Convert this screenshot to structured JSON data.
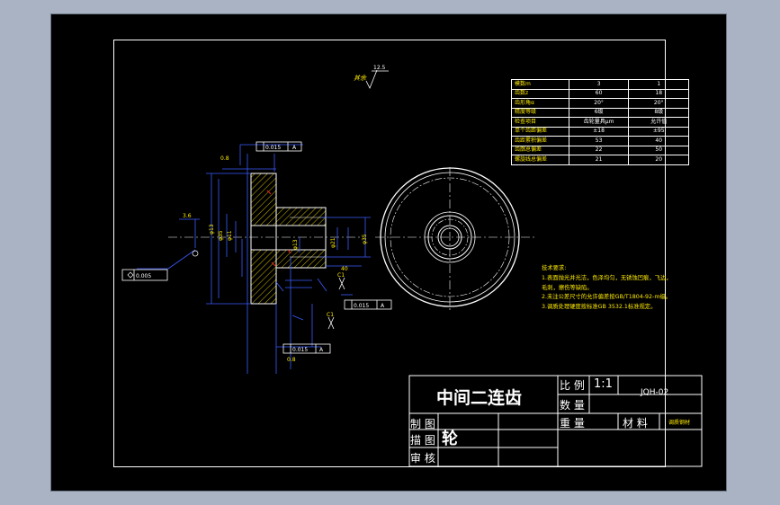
{
  "roughness": {
    "label": "其余",
    "value": "12.5"
  },
  "gear_table": [
    [
      "模数m",
      "3",
      "1"
    ],
    [
      "齿数z",
      "60",
      "18"
    ],
    [
      "齿形角α",
      "20°",
      "20°"
    ],
    [
      "精度等级",
      "6级",
      "8级"
    ],
    [
      "检查项目",
      "齿轮量具μm",
      "允许值"
    ],
    [
      "单个齿距偏差",
      "±18",
      "±95"
    ],
    [
      "齿距累积偏差",
      "53",
      "40"
    ],
    [
      "齿廓总偏差",
      "22",
      "50"
    ],
    [
      "螺旋线总偏差",
      "21",
      "20"
    ]
  ],
  "tech_notes": {
    "title": "技术要求:",
    "lines": [
      "1.表面抛光并光洁，色泽均匀，无锈蚀凹痕，飞边，",
      "   毛刺，擦伤等缺陷。",
      "2.未注公差尺寸的允许偏差按GB/T1804-92-m级。",
      "3.调质处理硬度按标准GB 3532.1标准规定。"
    ]
  },
  "dimensions": {
    "flatness": "0.005",
    "runout_1": "0.015",
    "runout_2": "0.015",
    "runout_3": "0.015",
    "datum": "A",
    "d_small": "φ13",
    "d_mid": "φ35",
    "d_big": "φ11",
    "d_right": "φ21",
    "length": "40",
    "chamfer_1": "C1",
    "chamfer_2": "C1",
    "dim_08": "0.8",
    "dim_36": "3.6",
    "dim_bottom": "0.8"
  },
  "title_block": {
    "part_name": "中间二连齿",
    "part_name_cont": "轮",
    "scale_label": "比 例",
    "scale_value": "1:1",
    "drawing_no": "JQH-02",
    "quantity_label": "数 量",
    "weight_label": "重 量",
    "material_label": "材 料",
    "material_value": "调质钢材",
    "drawn_label": "制 图",
    "drafted_label": "描 图",
    "checked_label": "审 核"
  }
}
